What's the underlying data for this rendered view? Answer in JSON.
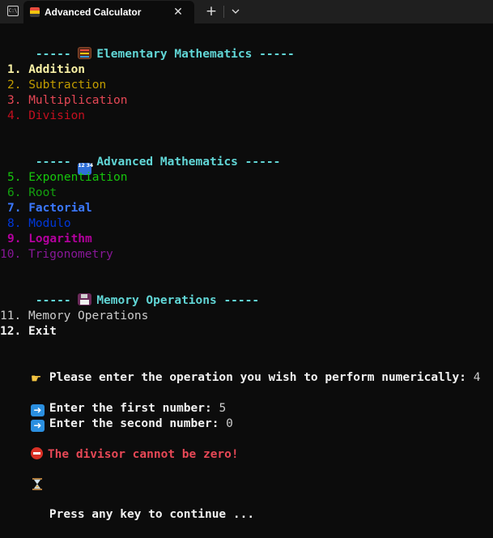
{
  "window": {
    "tab_title": "Advanced Calculator",
    "app_icon_text": "C:\\",
    "close_glyph": "✕",
    "new_tab_glyph": "+"
  },
  "colors": {
    "addition": "#f9f1a5",
    "subtraction": "#c19c00",
    "multiplication": "#e74856",
    "division": "#c50f1f",
    "exponentiation": "#16c60c",
    "root": "#13a10e",
    "factorial": "#3b78ff",
    "modulo": "#0037da",
    "logarithm": "#b4009e",
    "trigonometry": "#881798",
    "header": "#61d6d6",
    "error": "#e74856"
  },
  "sections": {
    "elementary": {
      "prefix": "----- ",
      "title": "Elementary Mathematics",
      "suffix": " -----",
      "icon": "abacus-icon"
    },
    "advanced": {
      "prefix": "----- ",
      "title": "Advanced Mathematics",
      "suffix": " -----",
      "icon": "input-numbers-icon",
      "icon_text": "12 34"
    },
    "memory": {
      "prefix": "----- ",
      "title": "Memory Operations",
      "suffix": " -----",
      "icon": "floppy-disk-icon"
    }
  },
  "menu": [
    {
      "num": "1.",
      "label": "Addition"
    },
    {
      "num": "2.",
      "label": "Subtraction"
    },
    {
      "num": "3.",
      "label": "Multiplication"
    },
    {
      "num": "4.",
      "label": "Division"
    },
    {
      "num": "5.",
      "label": "Exponentiation"
    },
    {
      "num": "6.",
      "label": "Root"
    },
    {
      "num": "7.",
      "label": "Factorial"
    },
    {
      "num": "8.",
      "label": "Modulo"
    },
    {
      "num": "9.",
      "label": "Logarithm"
    },
    {
      "num": "10.",
      "label": "Trigonometry"
    },
    {
      "num": "11.",
      "label": "Memory Operations"
    },
    {
      "num": "12.",
      "label": "Exit"
    }
  ],
  "prompts": {
    "operation": {
      "icon": "pointing-hand-icon",
      "text": "Please enter the operation you wish to perform numerically: ",
      "value": "4"
    },
    "first": {
      "icon": "right-arrow-icon",
      "text": "Enter the first number: ",
      "value": "5"
    },
    "second": {
      "icon": "right-arrow-icon",
      "text": "Enter the second number: ",
      "value": "0"
    },
    "error": {
      "icon": "no-entry-icon",
      "text": "The divisor cannot be zero!"
    },
    "continue": {
      "icon": "hourglass-icon",
      "text": "Press any key to continue ..."
    }
  }
}
